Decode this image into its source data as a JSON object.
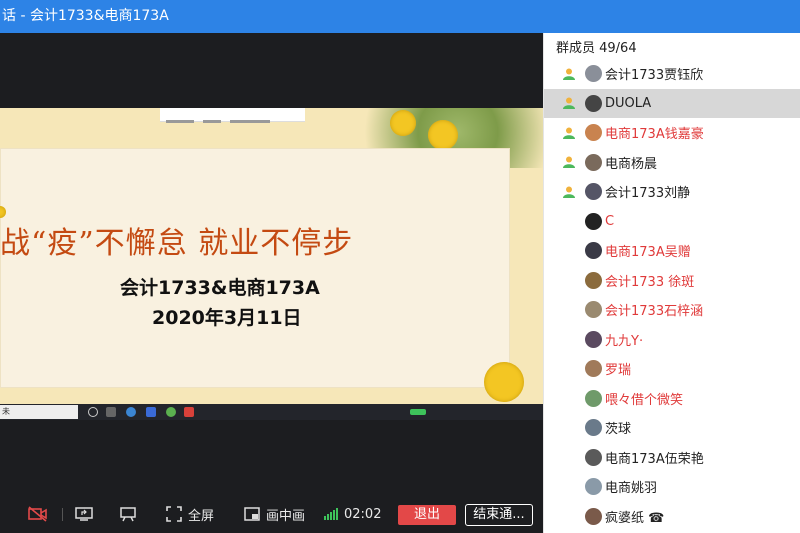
{
  "window": {
    "title": "话 - 会计1733&电商173A"
  },
  "slide": {
    "slogan": "战“疫”不懈怠 就业不停步",
    "class_line": "会计1733&电商173A",
    "date_line": "2020年3月11日",
    "taskbar_search": "未"
  },
  "controls": {
    "fullscreen_label": "全屏",
    "pip_label": "画中画",
    "timer": "02:02",
    "exit_label": "退出",
    "end_label": "结束通..."
  },
  "members": {
    "title": "群成员 49/64",
    "list": [
      {
        "name": "会计1733贾钰欣",
        "color": "#222222",
        "host": true
      },
      {
        "name": "DUOLA",
        "color": "#222222",
        "host": true,
        "selected": true
      },
      {
        "name": "电商173A钱嘉豪",
        "color": "#e03a3a",
        "host": true
      },
      {
        "name": "电商杨晨",
        "color": "#222222",
        "host": true
      },
      {
        "name": "会计1733刘静",
        "color": "#222222",
        "host": true
      },
      {
        "name": "C",
        "color": "#e03a3a",
        "host": false
      },
      {
        "name": "电商173A吴赠",
        "color": "#e03a3a",
        "host": false
      },
      {
        "name": "会计1733 徐斑",
        "color": "#e03a3a",
        "host": false
      },
      {
        "name": "会计1733石梓涵",
        "color": "#e03a3a",
        "host": false
      },
      {
        "name": "九九Y·",
        "color": "#e03a3a",
        "host": false
      },
      {
        "name": "罗瑞",
        "color": "#e03a3a",
        "host": false
      },
      {
        "name": "喂々借个微笑",
        "color": "#e03a3a",
        "host": false
      },
      {
        "name": "茨球",
        "color": "#222222",
        "host": false
      },
      {
        "name": "电商173A伍荣艳",
        "color": "#222222",
        "host": false
      },
      {
        "name": "电商姚羽",
        "color": "#222222",
        "host": false
      },
      {
        "name": "疯婆纸 ☎",
        "color": "#222222",
        "host": false
      }
    ]
  }
}
